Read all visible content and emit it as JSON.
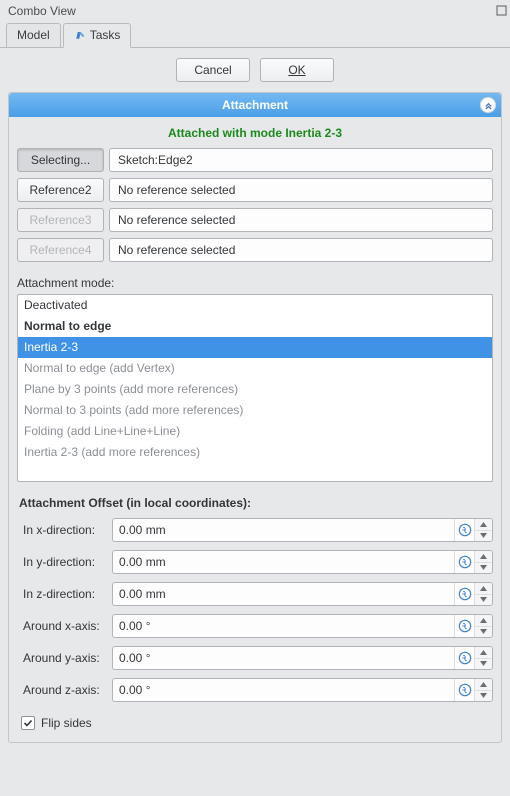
{
  "window": {
    "title": "Combo View"
  },
  "tabs": {
    "model": "Model",
    "tasks": "Tasks",
    "active": "tasks"
  },
  "buttons": {
    "cancel": "Cancel",
    "ok": "OK"
  },
  "section": {
    "title": "Attachment",
    "status": "Attached with mode Inertia 2-3",
    "refs": [
      {
        "button": "Selecting...",
        "value": "Sketch:Edge2",
        "state": "sunken"
      },
      {
        "button": "Reference2",
        "value": "No reference selected",
        "state": "normal"
      },
      {
        "button": "Reference3",
        "value": "No reference selected",
        "state": "disabled"
      },
      {
        "button": "Reference4",
        "value": "No reference selected",
        "state": "disabled"
      }
    ],
    "mode_label": "Attachment mode:",
    "modes": [
      {
        "text": "Deactivated",
        "style": ""
      },
      {
        "text": "Normal to edge",
        "style": "bold"
      },
      {
        "text": "Inertia 2-3",
        "style": "selected"
      },
      {
        "text": "Normal to edge (add Vertex)",
        "style": "dim"
      },
      {
        "text": "Plane by 3 points (add more references)",
        "style": "dim"
      },
      {
        "text": "Normal to 3 points (add more references)",
        "style": "dim"
      },
      {
        "text": "Folding (add Line+Line+Line)",
        "style": "dim"
      },
      {
        "text": "Inertia 2-3 (add more references)",
        "style": "dim"
      }
    ],
    "offset_label": "Attachment Offset (in local coordinates):",
    "offsets": [
      {
        "label": "In x-direction:",
        "value": "0.00 mm"
      },
      {
        "label": "In y-direction:",
        "value": "0.00 mm"
      },
      {
        "label": "In z-direction:",
        "value": "0.00 mm"
      },
      {
        "label": "Around x-axis:",
        "value": "0.00 °"
      },
      {
        "label": "Around y-axis:",
        "value": "0.00 °"
      },
      {
        "label": "Around z-axis:",
        "value": "0.00 °"
      }
    ],
    "flip": {
      "label": "Flip sides",
      "checked": true
    }
  }
}
